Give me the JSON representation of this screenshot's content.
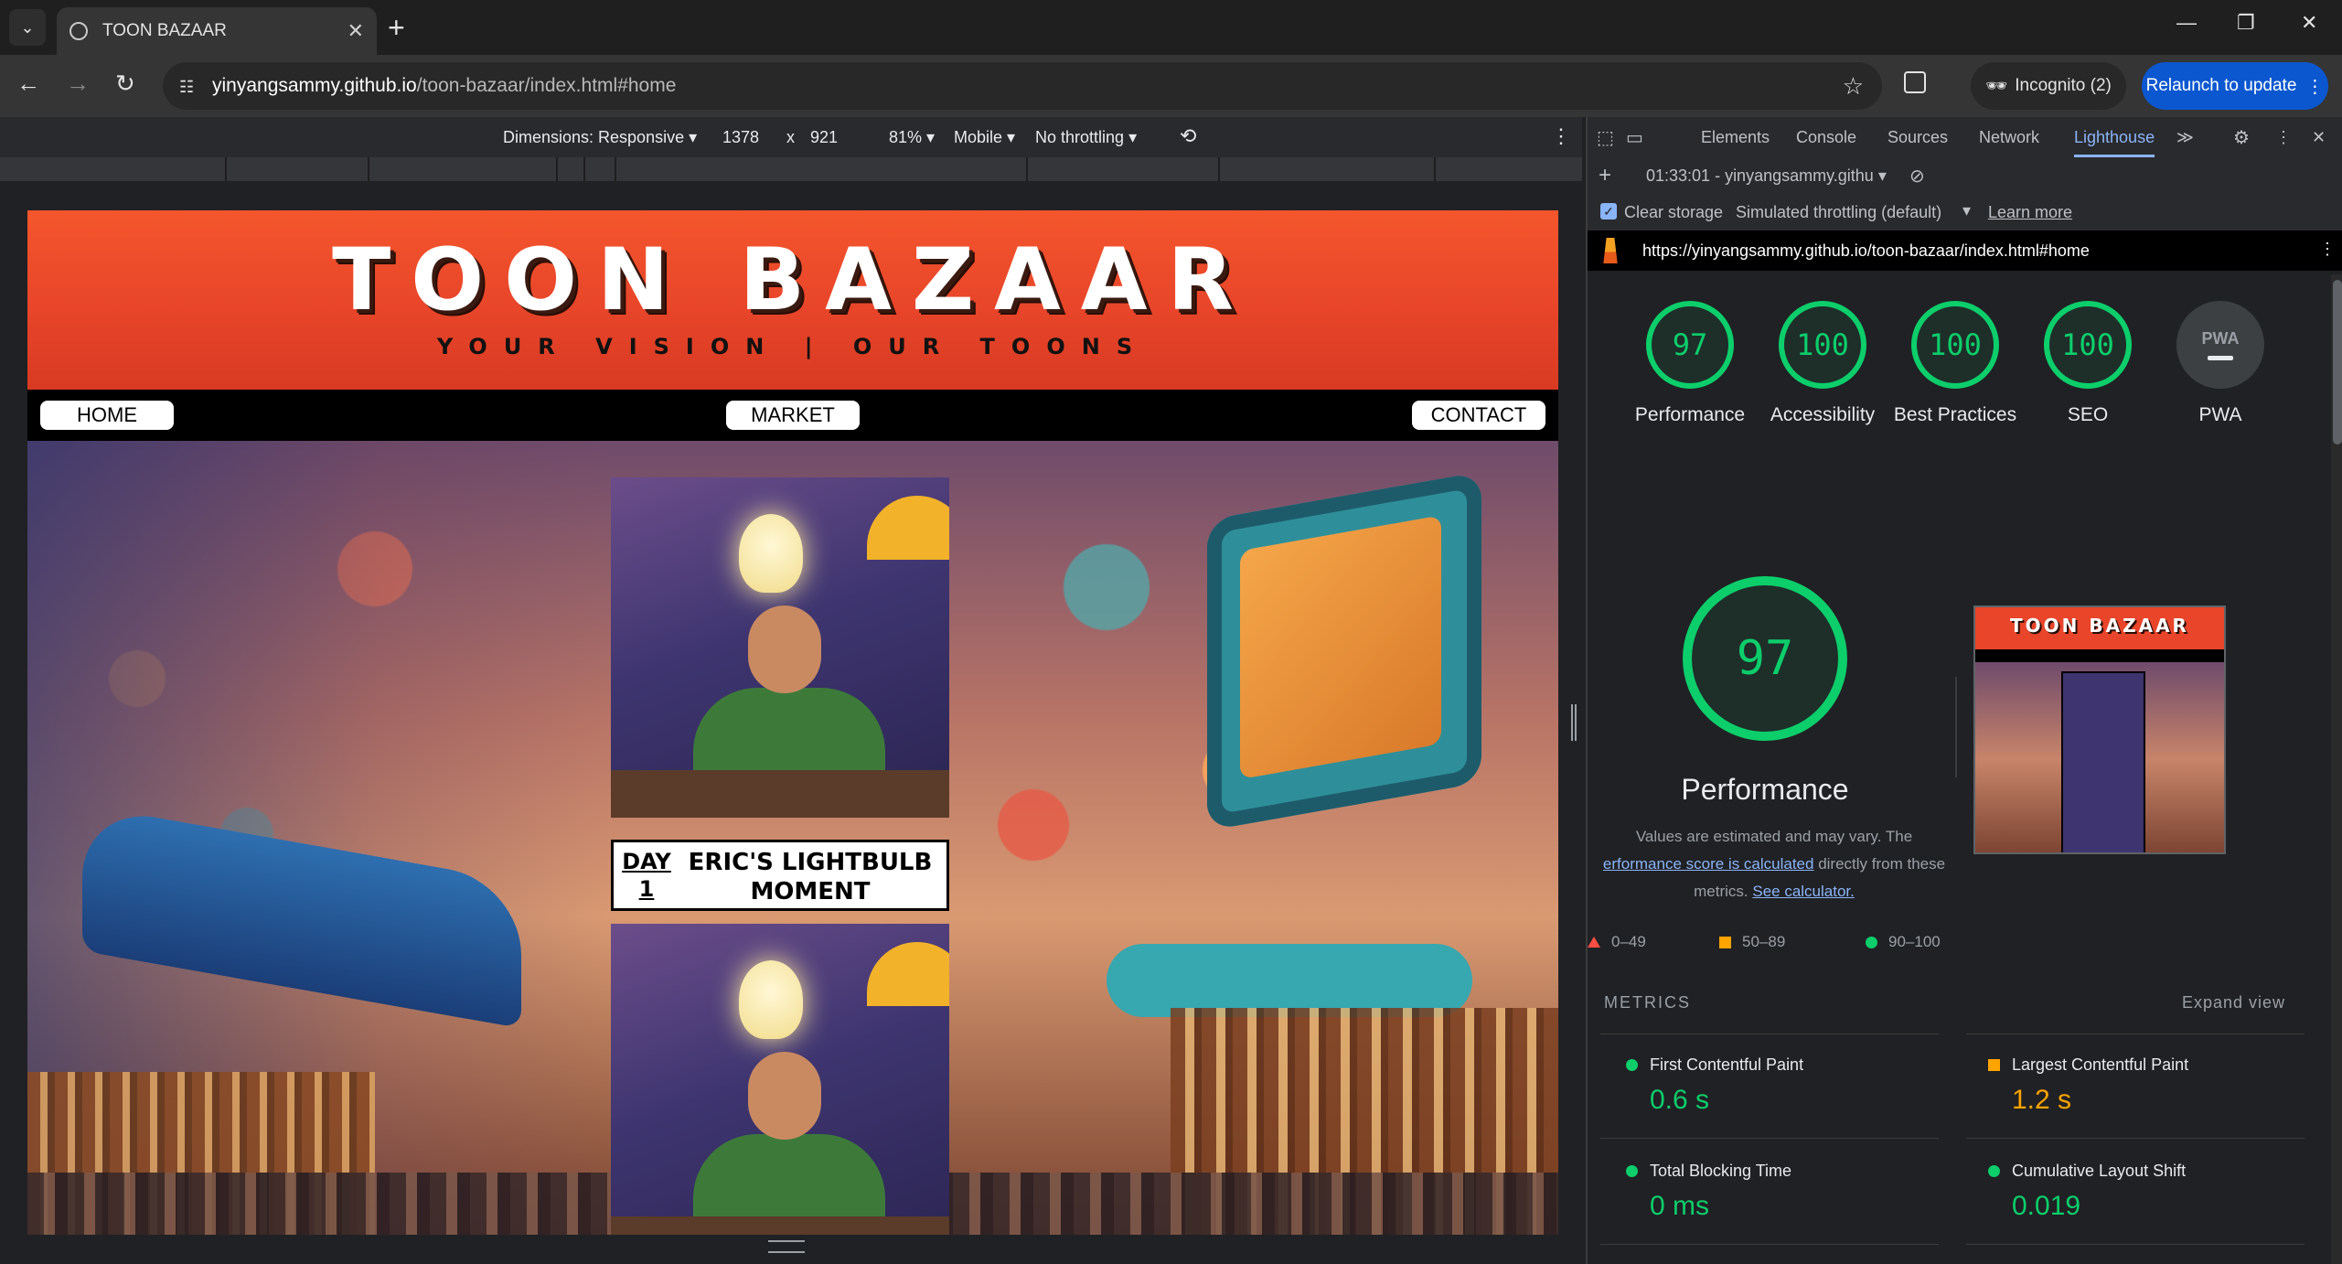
{
  "browser": {
    "tab_title": "TOON BAZAAR",
    "url_host": "yinyangsammy.github.io",
    "url_path": "/toon-bazaar/index.html#home",
    "incognito_label": "Incognito (2)",
    "relaunch_label": "Relaunch to update"
  },
  "device_toolbar": {
    "dimensions_label": "Dimensions: Responsive",
    "width": "1378",
    "times": "x",
    "height": "921",
    "zoom": "81%",
    "device_type": "Mobile",
    "throttling": "No throttling"
  },
  "site": {
    "brand": "TOON BAZAAR",
    "tagline": "YOUR VISION | OUR TOONS",
    "nav": [
      "HOME",
      "MARKET",
      "CONTACT"
    ],
    "comic_day": "DAY 1",
    "comic_title": "ERIC'S LIGHTBULB MOMENT"
  },
  "devtools": {
    "tabs": [
      "Elements",
      "Console",
      "Sources",
      "Network",
      "Lighthouse"
    ],
    "active_tab": "Lighthouse",
    "report_label": "01:33:01 - yinyangsammy.githu",
    "clear_storage": "Clear storage",
    "throttling": "Simulated throttling (default)",
    "learn_more": "Learn more",
    "audited_url": "https://yinyangsammy.github.io/toon-bazaar/index.html#home",
    "scores": [
      {
        "label": "Performance",
        "value": "97"
      },
      {
        "label": "Accessibility",
        "value": "100"
      },
      {
        "label": "Best Practices",
        "value": "100"
      },
      {
        "label": "SEO",
        "value": "100"
      },
      {
        "label": "PWA",
        "value": "PWA"
      }
    ],
    "big_score": "97",
    "big_title": "Performance",
    "note_1": "Values are estimated and may vary. The",
    "note_link_1": "erformance score is calculated",
    "note_2": " directly from these",
    "note_3": "metrics. ",
    "note_link_2": "See calculator.",
    "legend": [
      "0–49",
      "50–89",
      "90–100"
    ],
    "metrics_heading": "METRICS",
    "expand_view": "Expand view",
    "metrics": [
      {
        "name": "First Contentful Paint",
        "value": "0.6 s",
        "status": "pass"
      },
      {
        "name": "Largest Contentful Paint",
        "value": "1.2 s",
        "status": "average"
      },
      {
        "name": "Total Blocking Time",
        "value": "0 ms",
        "status": "pass"
      },
      {
        "name": "Cumulative Layout Shift",
        "value": "0.019",
        "status": "pass"
      }
    ],
    "thumbnail_title": "TOON BAZAAR"
  },
  "colors": {
    "pass": "#0cce6b",
    "average": "#ffa400",
    "fail": "#ff4e42",
    "accent": "#8ab4f8",
    "relaunch": "#0b57d0"
  }
}
